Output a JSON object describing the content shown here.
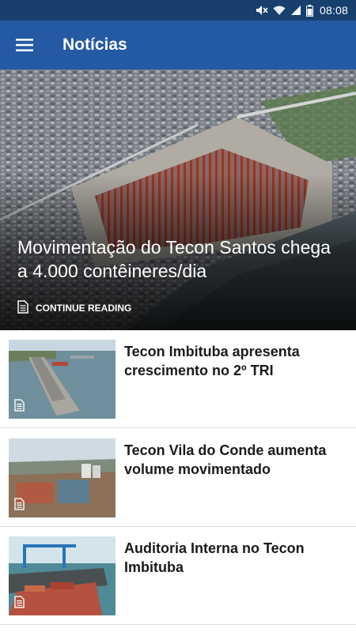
{
  "status_bar": {
    "time": "08:08"
  },
  "app_bar": {
    "title": "Notícias",
    "menu_icon": "hamburger-menu-icon"
  },
  "featured": {
    "title": "Movimentação do Tecon Santos chega a 4.000 contêineres/dia",
    "cta": "CONTINUE READING",
    "icon": "document-icon"
  },
  "news": [
    {
      "title": "Tecon Imbituba apresenta crescimento no 2º TRI"
    },
    {
      "title": "Tecon Vila do Conde aumenta volume movimentado"
    },
    {
      "title": "Auditoria Interna no Tecon Imbituba"
    }
  ],
  "colors": {
    "status_bar": "#17406f",
    "app_bar": "#2459a4",
    "divider": "#dcdcdc"
  }
}
